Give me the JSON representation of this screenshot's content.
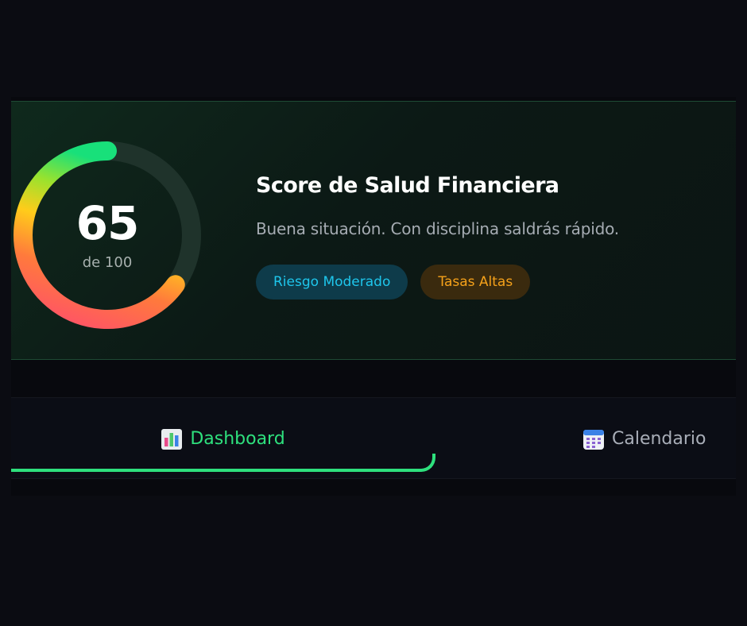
{
  "score_card": {
    "title": "Score de Salud Financiera",
    "description": "Buena situación. Con disciplina saldrás rápido.",
    "score": "65",
    "score_max_label": "de 100",
    "score_fraction": 0.65,
    "badges": [
      {
        "label": "Riesgo Moderado",
        "color": "#1ec6ec"
      },
      {
        "label": "Tasas Altas",
        "color": "#f5a11a"
      }
    ],
    "gauge_colors": [
      "#ff4d6d",
      "#ff8a3c",
      "#ffcc1a",
      "#9be22d",
      "#18e07a"
    ]
  },
  "tabs": [
    {
      "label": "Dashboard",
      "icon": "bar-chart-icon",
      "active": true
    },
    {
      "label": "Calendario",
      "icon": "calendar-icon",
      "active": false
    }
  ],
  "colors": {
    "accent": "#2ee07d",
    "background": "#0b0c12"
  }
}
